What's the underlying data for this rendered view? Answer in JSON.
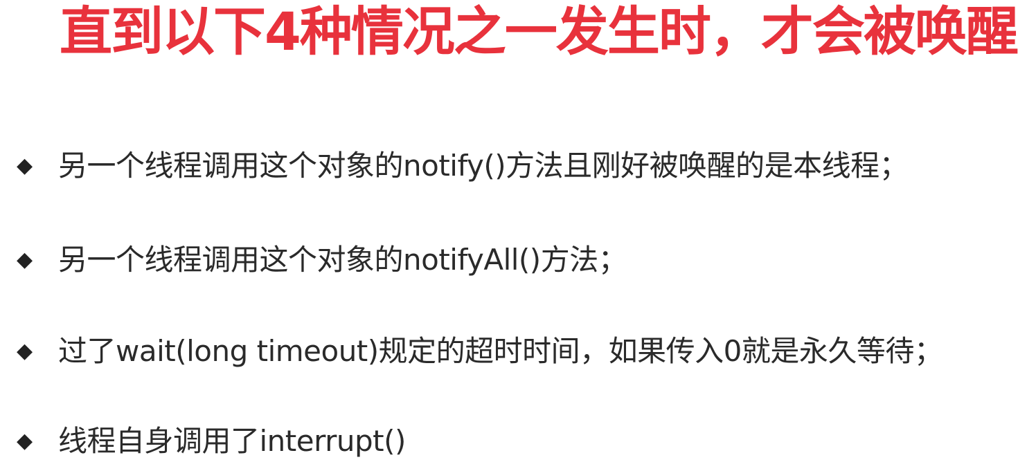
{
  "slide": {
    "title": "直到以下4种情况之一发生时，才会被唤醒",
    "colors": {
      "title": "#e8323c",
      "text": "#2a2a2a",
      "background": "#ffffff"
    },
    "bullet_icon": "diamond-bullet-icon",
    "bullets": [
      {
        "marker": "◆",
        "text": "另一个线程调用这个对象的notify()方法且刚好被唤醒的是本线程；"
      },
      {
        "marker": "◆",
        "text": "另一个线程调用这个对象的notifyAll()方法；"
      },
      {
        "marker": "◆",
        "text": "过了wait(long timeout)规定的超时时间，如果传入0就是永久等待；"
      },
      {
        "marker": "◆",
        "text": "线程自身调用了interrupt()"
      }
    ]
  }
}
